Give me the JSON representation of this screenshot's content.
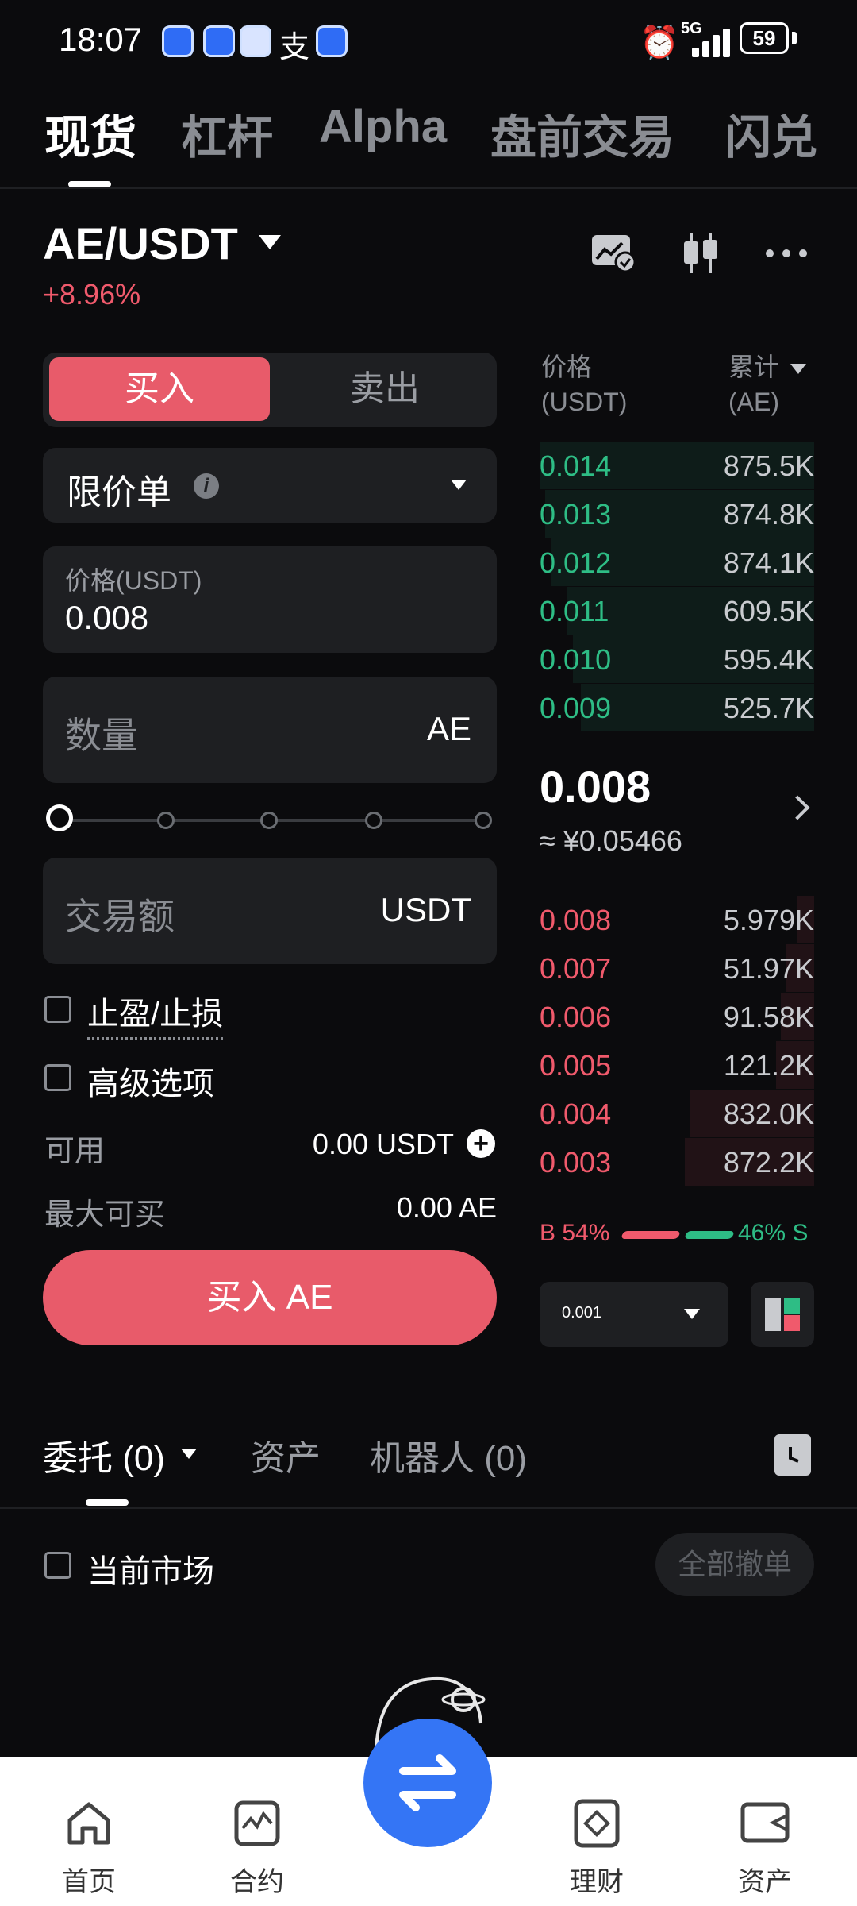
{
  "status_bar": {
    "time": "18:07",
    "zhi_glyph": "支",
    "network": "5G",
    "battery": "59"
  },
  "top_tabs": [
    "现货",
    "杠杆",
    "Alpha",
    "盘前交易",
    "闪兑"
  ],
  "pair": {
    "symbol": "AE/USDT",
    "change": "+8.96%"
  },
  "order_form": {
    "buy_label": "买入",
    "sell_label": "卖出",
    "order_type": "限价单",
    "price_label": "价格(USDT)",
    "price_value": "0.008",
    "qty_label": "数量",
    "qty_unit": "AE",
    "amount_label": "交易额",
    "amount_unit": "USDT",
    "tpsl_label": "止盈/止损",
    "advanced_label": "高级选项",
    "available_label": "可用",
    "available_value": "0.00 USDT",
    "max_buy_label": "最大可买",
    "max_buy_value": "0.00 AE",
    "submit_label": "买入 AE"
  },
  "order_book": {
    "price_header_1": "价格",
    "price_header_2": "(USDT)",
    "qty_header_1": "累计",
    "qty_header_2": "(AE)",
    "bids": [
      {
        "price": "0.014",
        "qty": "875.5K",
        "depth": 1.0
      },
      {
        "price": "0.013",
        "qty": "874.8K",
        "depth": 0.98
      },
      {
        "price": "0.012",
        "qty": "874.1K",
        "depth": 0.96
      },
      {
        "price": "0.011",
        "qty": "609.5K",
        "depth": 0.9
      },
      {
        "price": "0.010",
        "qty": "595.4K",
        "depth": 0.88
      },
      {
        "price": "0.009",
        "qty": "525.7K",
        "depth": 0.85
      }
    ],
    "last_price": "0.008",
    "last_price_cny": "≈ ¥0.05466",
    "asks": [
      {
        "price": "0.008",
        "qty": "5.979K",
        "depth": 0.06
      },
      {
        "price": "0.007",
        "qty": "51.97K",
        "depth": 0.1
      },
      {
        "price": "0.006",
        "qty": "91.58K",
        "depth": 0.12
      },
      {
        "price": "0.005",
        "qty": "121.2K",
        "depth": 0.14
      },
      {
        "price": "0.004",
        "qty": "832.0K",
        "depth": 0.45
      },
      {
        "price": "0.003",
        "qty": "872.2K",
        "depth": 0.47
      }
    ],
    "buy_ratio": "B 54%",
    "sell_ratio": "46% S",
    "precision": "0.001"
  },
  "bottom_tabs": {
    "orders": "委托 (0)",
    "assets": "资产",
    "bots": "机器人 (0)"
  },
  "current_market_label": "当前市场",
  "cancel_all_label": "全部撤单",
  "bottom_nav": [
    "首页",
    "合约",
    "理财",
    "资产"
  ],
  "colors": {
    "buy": "#e85b6a",
    "bid_green": "#2ebd85",
    "ask_red": "#f05a6c",
    "fab": "#3475f5"
  }
}
